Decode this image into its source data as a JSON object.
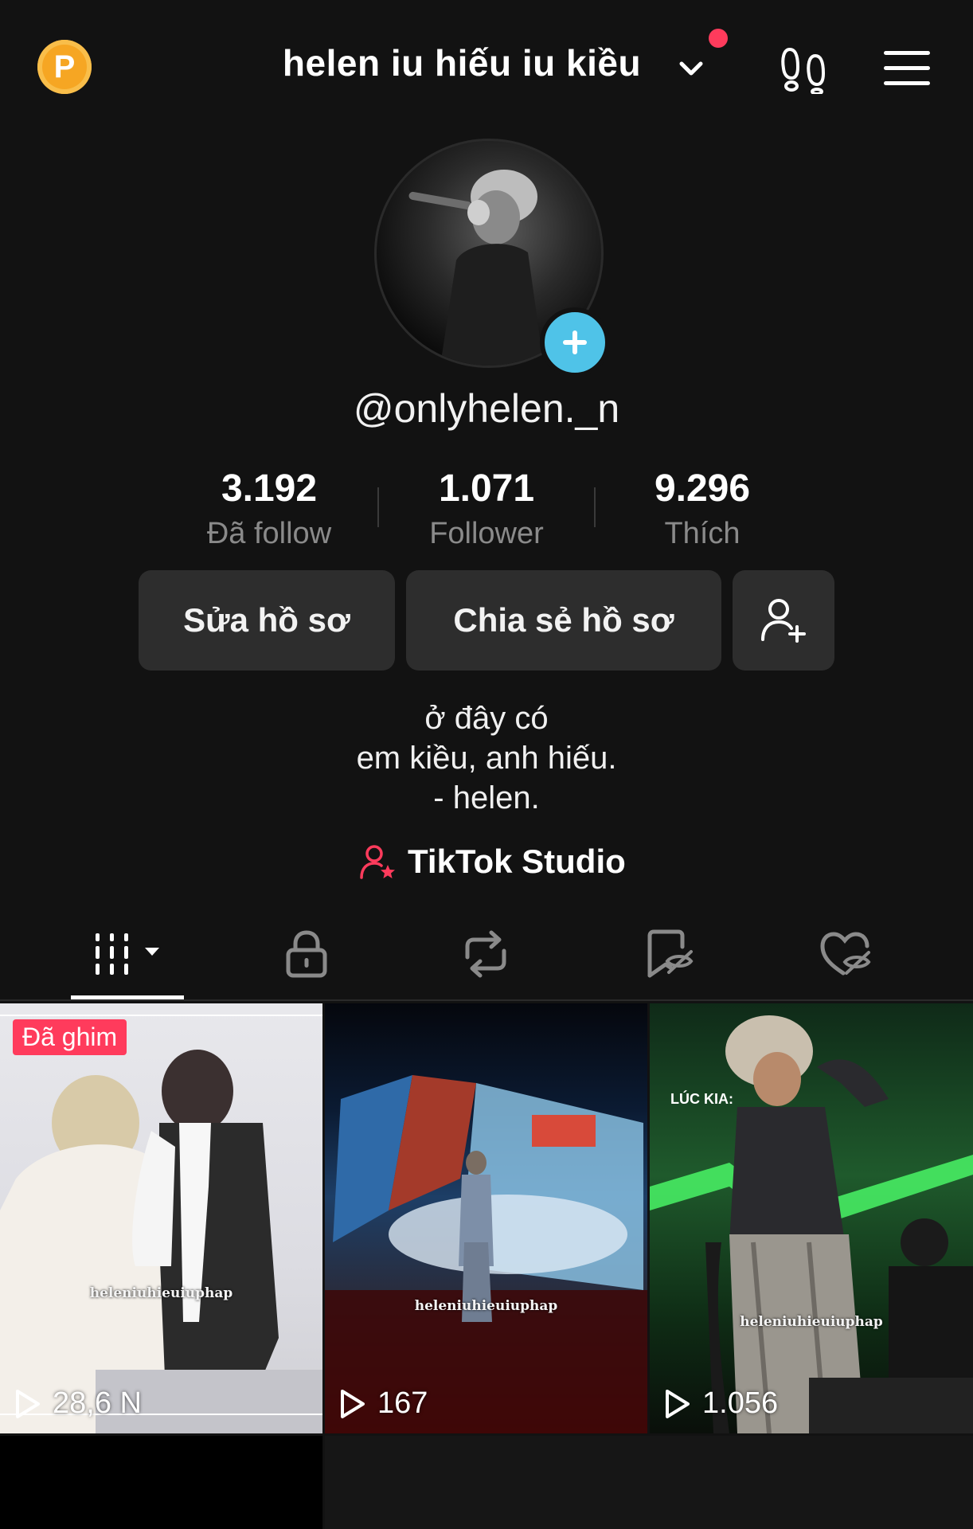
{
  "header": {
    "coin_label": "P",
    "account_name": "helen iu hiếu iu kiều",
    "icons": [
      "coin-icon",
      "chevron-down-icon",
      "footprints-icon",
      "menu-icon"
    ],
    "notification_dot_color": "#ff3b5c"
  },
  "profile": {
    "username": "@onlyhelen._n",
    "avatar_add_color": "#4fc3e8"
  },
  "stats": [
    {
      "value": "3.192",
      "label": "Đã follow"
    },
    {
      "value": "1.071",
      "label": "Follower"
    },
    {
      "value": "9.296",
      "label": "Thích"
    }
  ],
  "actions": {
    "edit_profile": "Sửa hồ sơ",
    "share_profile": "Chia sẻ hồ sơ",
    "add_friend_icon": "add-user-icon"
  },
  "bio": {
    "lines": [
      "ở đây có",
      "em kiều, anh hiếu.",
      "- helen."
    ]
  },
  "studio": {
    "label": "TikTok Studio",
    "icon_color": "#ff3b5c"
  },
  "tabs": [
    {
      "name": "videos",
      "icon": "grid-icon",
      "active": true
    },
    {
      "name": "private",
      "icon": "lock-icon"
    },
    {
      "name": "reposts",
      "icon": "repost-icon"
    },
    {
      "name": "saved",
      "icon": "bookmark-hidden-icon"
    },
    {
      "name": "liked",
      "icon": "heart-hidden-icon"
    }
  ],
  "videos": [
    {
      "pinned_label": "Đã ghim",
      "watermark": "heleniuhieuiuphap",
      "views": "28,6 N"
    },
    {
      "watermark": "heleniuhieuiuphap",
      "views": "167"
    },
    {
      "caption": "LÚC KIA:",
      "watermark": "heleniuhieuiuphap",
      "views": "1.056"
    }
  ]
}
